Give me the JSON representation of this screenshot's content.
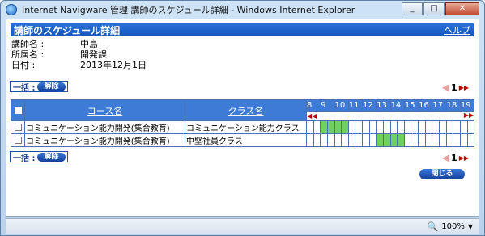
{
  "window": {
    "title": "Internet Navigware 管理 講師のスケジュール詳細 - Windows Internet Explorer",
    "minimize": "_",
    "maximize": "□",
    "close": "✕"
  },
  "header": {
    "title": "講師のスケジュール詳細",
    "help": "ヘルプ"
  },
  "info": [
    {
      "label": "講師名 :",
      "value": "中島"
    },
    {
      "label": "所属名 :",
      "value": "開発課"
    },
    {
      "label": "日付 :",
      "value": "2013年12月1日"
    }
  ],
  "bulk": {
    "label": "一括 :",
    "release": "解除"
  },
  "pager": {
    "prev": "◀",
    "page": "1",
    "next": "▶▶"
  },
  "table": {
    "col_course": "コース名",
    "col_class": "クラス名",
    "hours": [
      "8",
      "9",
      "10",
      "11",
      "12",
      "13",
      "14",
      "15",
      "16",
      "17",
      "18",
      "19"
    ],
    "scroll_left": "◀◀",
    "scroll_right": "▶▶",
    "rows": [
      {
        "course": "コミュニケーション能力開発(集合教育)",
        "class": "コミュニケーション能力クラス",
        "slots": [
          0,
          0,
          1,
          1,
          1,
          1,
          0,
          0,
          0,
          0,
          0,
          0,
          0,
          0,
          0,
          0,
          0,
          0,
          0,
          0,
          0,
          0,
          0,
          0
        ]
      },
      {
        "course": "コミュニケーション能力開発(集合教育)",
        "class": "中堅社員クラス",
        "slots": [
          0,
          0,
          0,
          0,
          0,
          0,
          0,
          0,
          0,
          0,
          1,
          1,
          1,
          1,
          0,
          0,
          0,
          0,
          0,
          0,
          0,
          0,
          0,
          0
        ]
      }
    ]
  },
  "close_button": "閉じる",
  "status": {
    "zoom": "100%"
  },
  "colors": {
    "header_blue": "#1657be",
    "table_header": "#3e7bd6",
    "busy_slot": "#6fcf60",
    "pager_arrow": "#c00000"
  }
}
